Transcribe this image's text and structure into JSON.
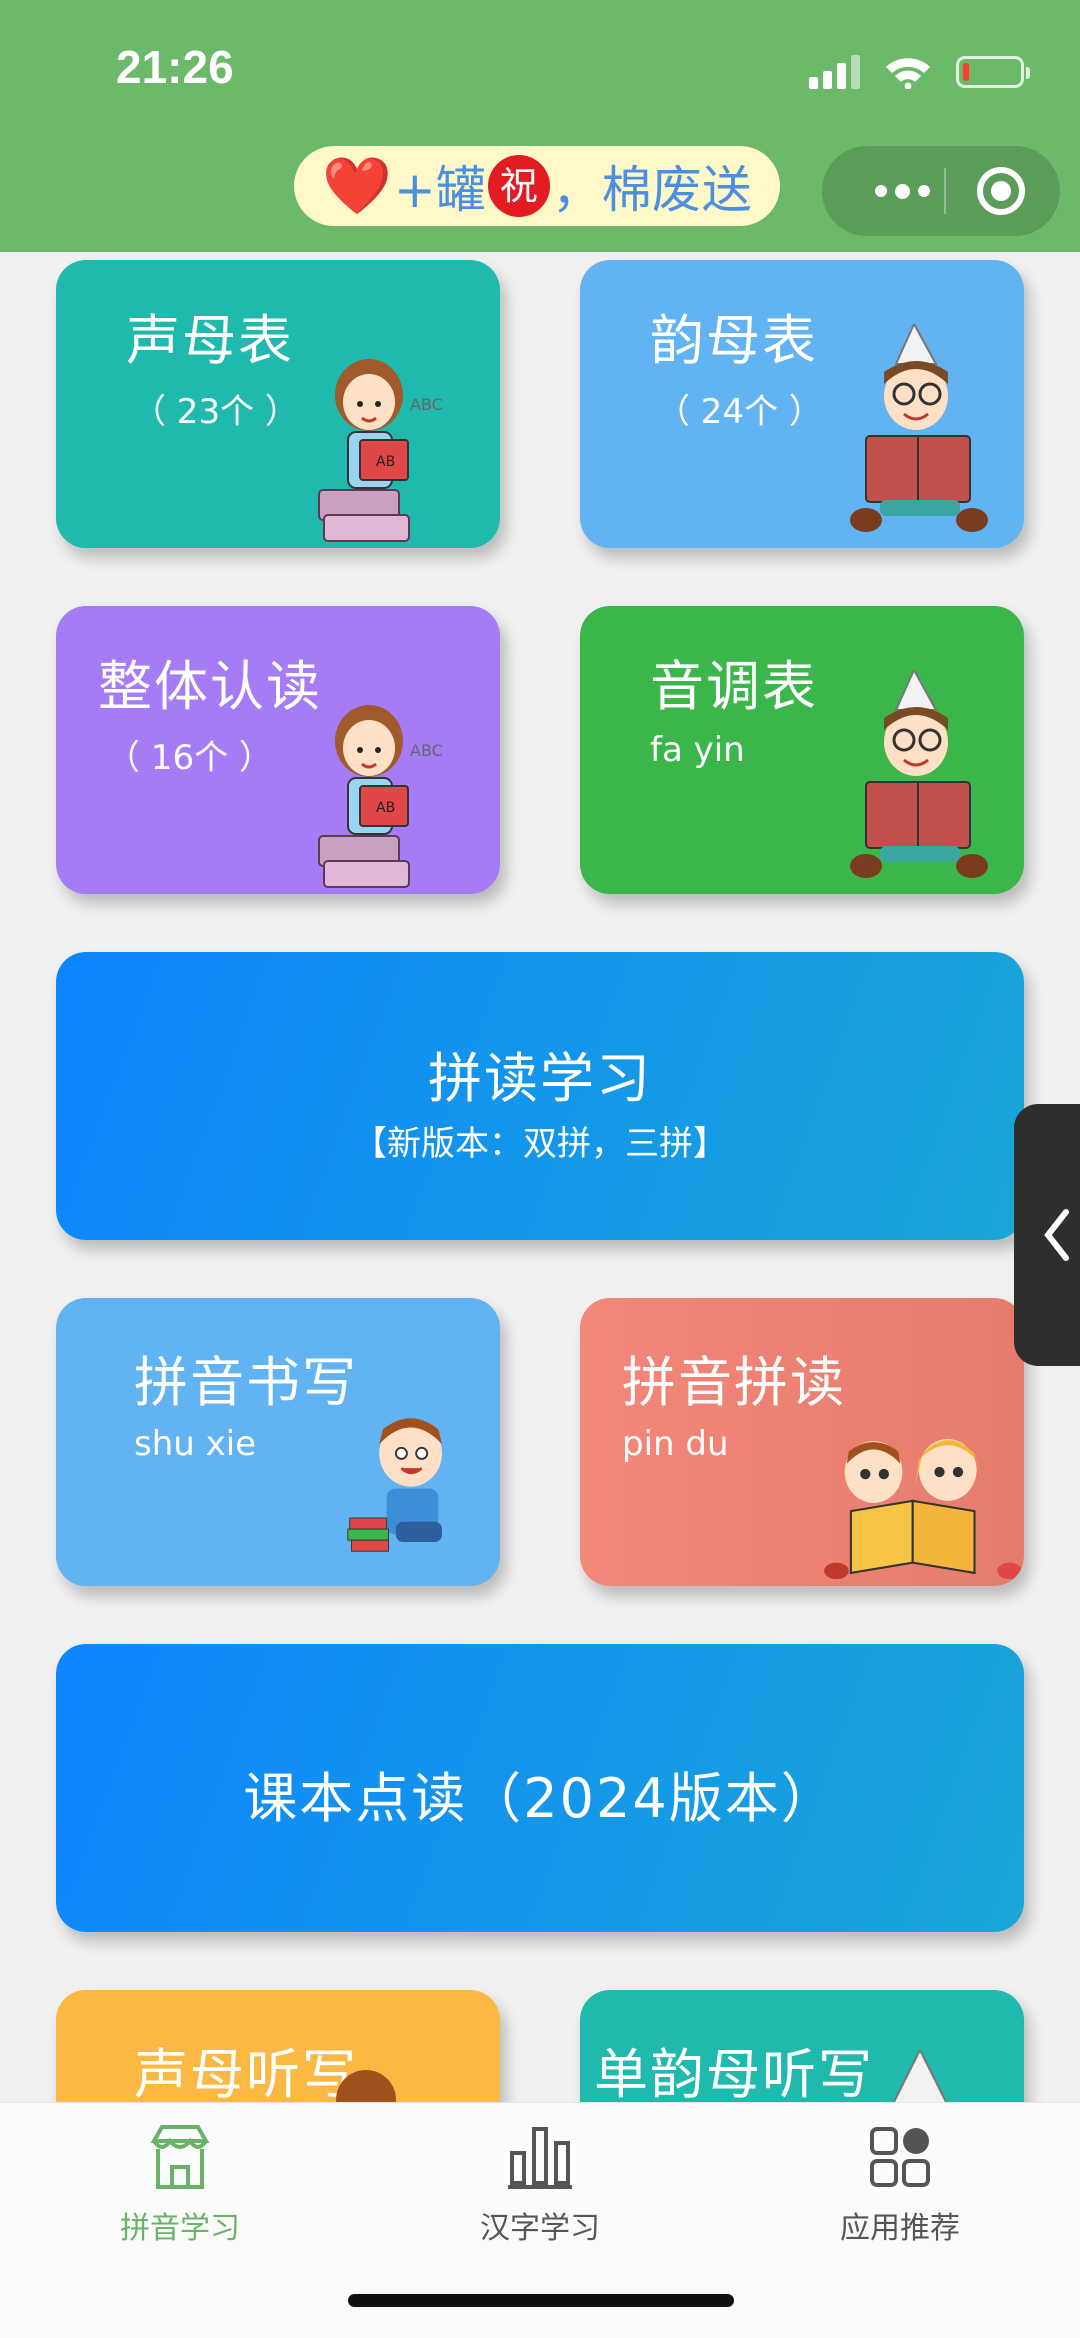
{
  "status": {
    "time": "21:26"
  },
  "header": {
    "title_parts": {
      "heart": "❤️",
      "a": "+罐",
      "badge": "祝",
      "b": "，棉废送"
    },
    "colors": {
      "bar": "#6cb96a"
    }
  },
  "cards": {
    "shengmu": {
      "title": "声母表",
      "sub": "（ 23个 ）",
      "color": "#1fb9ae"
    },
    "yunmu": {
      "title": "韵母表",
      "sub": "（ 24个 ）",
      "color": "#62b3f2"
    },
    "zhengti": {
      "title": "整体认读",
      "sub": "（ 16个 ）",
      "color": "#a57bf6"
    },
    "yindiao": {
      "title": "音调表",
      "sub": "fa yin",
      "color": "#3bb64b"
    },
    "pindu_study": {
      "title": "拼读学习",
      "sub": "【新版本：双拼，三拼】"
    },
    "shuxie": {
      "title": "拼音书写",
      "sub": "shu xie",
      "color": "#62b3f2"
    },
    "pindu": {
      "title": "拼音拼读",
      "sub": "pin du",
      "color": "#f08576"
    },
    "keben": {
      "title": "课本点读（2024版本）"
    },
    "shengmu_tingxie": {
      "title": "声母听写",
      "color": "#fbb843"
    },
    "danyunmu_tingxie": {
      "title": "单韵母听写",
      "color": "#1fb9ae"
    }
  },
  "tabbar": {
    "items": [
      {
        "label": "拼音学习",
        "icon": "store-icon",
        "active": true
      },
      {
        "label": "汉字学习",
        "icon": "bar-chart-icon",
        "active": false
      },
      {
        "label": "应用推荐",
        "icon": "apps-grid-icon",
        "active": false
      }
    ],
    "active_color": "#68b368"
  }
}
